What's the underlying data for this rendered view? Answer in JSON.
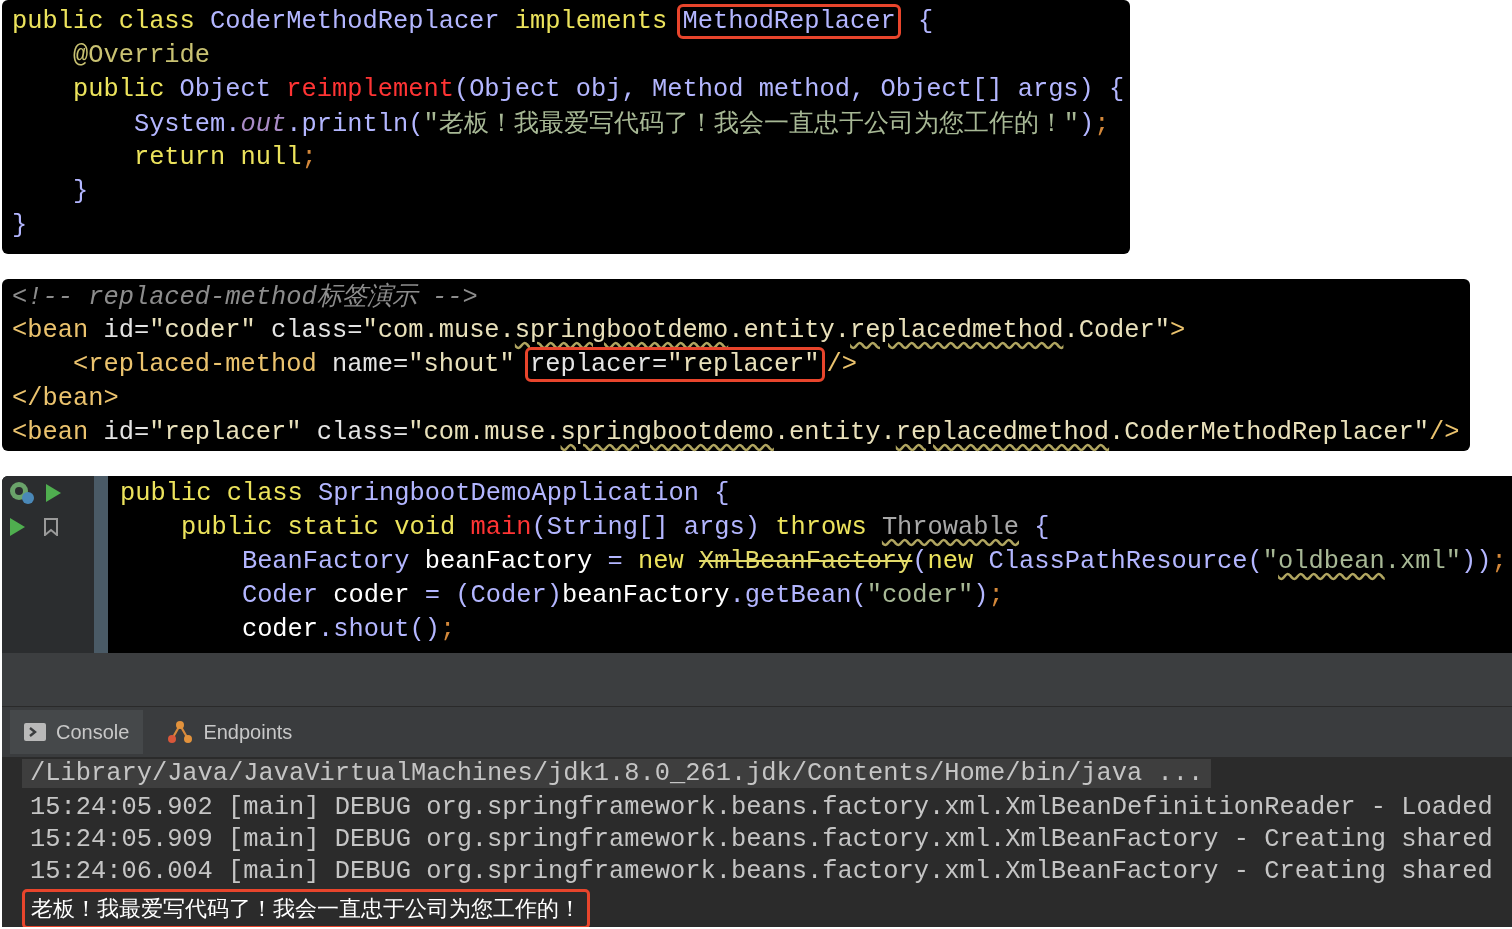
{
  "snippets": [
    {
      "lines": [
        {
          "tokens": [
            {
              "kind": "kw",
              "text": "public class "
            },
            {
              "kind": "type",
              "text": "CoderMethodReplacer "
            },
            {
              "kind": "kw",
              "text": "implements "
            }
          ],
          "boxed": [
            {
              "kind": "type",
              "text": "MethodReplacer"
            }
          ],
          "after": [
            {
              "kind": "type",
              "text": " {"
            }
          ]
        },
        {
          "tokens": [
            {
              "kind": "ann",
              "text": "    @Override"
            }
          ]
        },
        {
          "tokens": [
            {
              "kind": "kw",
              "text": "    public "
            },
            {
              "kind": "type",
              "text": "Object "
            },
            {
              "kind": "method",
              "text": "reimplement"
            },
            {
              "kind": "type",
              "text": "(Object obj, Method method, Object[] args) {"
            }
          ]
        },
        {
          "tokens": [
            {
              "kind": "type",
              "text": "        System."
            },
            {
              "kind": "field",
              "text": "out"
            },
            {
              "kind": "type",
              "text": ".println("
            },
            {
              "kind": "str",
              "text": "\"老板！我最爱写代码了！我会一直忠于公司为您工作的！\""
            },
            {
              "kind": "type",
              "text": ")"
            },
            {
              "kind": "punct",
              "text": ";"
            }
          ]
        },
        {
          "tokens": [
            {
              "kind": "kw",
              "text": "        return null"
            },
            {
              "kind": "punct",
              "text": ";"
            }
          ]
        },
        {
          "tokens": [
            {
              "kind": "type",
              "text": "    }"
            }
          ]
        },
        {
          "tokens": [
            {
              "kind": "type",
              "text": "}"
            }
          ]
        }
      ]
    },
    {
      "lines": [
        {
          "tokens": [
            {
              "kind": "comment",
              "text": "<!-- replaced-method标签演示 -->"
            }
          ]
        },
        {
          "tokens": [
            {
              "kind": "tag",
              "text": "<bean "
            },
            {
              "kind": "attr",
              "text": "id="
            },
            {
              "kind": "val",
              "text": "\"coder\" "
            },
            {
              "kind": "attr",
              "text": "class="
            },
            {
              "kind": "val",
              "text": "\"com.muse."
            },
            {
              "kind": "val",
              "text": "springbootdemo",
              "warned": true
            },
            {
              "kind": "val",
              "text": ".entity."
            },
            {
              "kind": "val",
              "text": "replacedmethod",
              "warned": true
            },
            {
              "kind": "val",
              "text": ".Coder\""
            },
            {
              "kind": "tag",
              "text": ">"
            }
          ]
        },
        {
          "tokens": [
            {
              "kind": "tag",
              "text": "    <replaced-method "
            },
            {
              "kind": "attr",
              "text": "name="
            },
            {
              "kind": "val",
              "text": "\"shout\" "
            }
          ],
          "boxed": [
            {
              "kind": "attr",
              "text": "replacer="
            },
            {
              "kind": "val",
              "text": "\"replacer\""
            }
          ],
          "after": [
            {
              "kind": "tag",
              "text": "/>"
            }
          ]
        },
        {
          "tokens": [
            {
              "kind": "tag",
              "text": "</bean>"
            }
          ]
        },
        {
          "tokens": [
            {
              "kind": "tag",
              "text": "<bean "
            },
            {
              "kind": "attr",
              "text": "id="
            },
            {
              "kind": "val",
              "text": "\"replacer\" "
            },
            {
              "kind": "attr",
              "text": "class="
            },
            {
              "kind": "val",
              "text": "\"com.muse."
            },
            {
              "kind": "val",
              "text": "springbootdemo",
              "warned": true
            },
            {
              "kind": "val",
              "text": ".entity."
            },
            {
              "kind": "val",
              "text": "replacedmethod",
              "warned": true
            },
            {
              "kind": "val",
              "text": ".CoderMethodReplacer\""
            },
            {
              "kind": "tag",
              "text": "/>"
            }
          ]
        }
      ]
    }
  ],
  "ide": {
    "lines": [
      {
        "tokens": [
          {
            "kind": "kw",
            "text": "public class "
          },
          {
            "kind": "type",
            "text": "SpringbootDemoApplication {"
          }
        ]
      },
      {
        "tokens": [
          {
            "kind": "kw",
            "text": "    public static void "
          },
          {
            "kind": "method",
            "text": "main"
          },
          {
            "kind": "type",
            "text": "(String[] args) "
          },
          {
            "kind": "kw",
            "text": "throws "
          },
          {
            "kind": "dim",
            "text": "Throwable",
            "warned": true
          },
          {
            "kind": "type",
            "text": " {"
          }
        ]
      },
      {
        "tokens": [
          {
            "kind": "type",
            "text": "        BeanFactory "
          },
          {
            "kind": "plain",
            "text": "beanFactory "
          },
          {
            "kind": "type",
            "text": "= "
          },
          {
            "kind": "kw",
            "text": "new "
          },
          {
            "kind": "deprecated",
            "text": "XmlBeanFactory"
          },
          {
            "kind": "type",
            "text": "("
          },
          {
            "kind": "kw",
            "text": "new "
          },
          {
            "kind": "type",
            "text": "ClassPathResource("
          },
          {
            "kind": "str",
            "text": "\""
          },
          {
            "kind": "str",
            "text": "oldbean",
            "warned": true
          },
          {
            "kind": "str",
            "text": ".xml\""
          },
          {
            "kind": "type",
            "text": "))"
          },
          {
            "kind": "punct",
            "text": ";"
          }
        ]
      },
      {
        "tokens": [
          {
            "kind": "type",
            "text": "        Coder "
          },
          {
            "kind": "plain",
            "text": "coder "
          },
          {
            "kind": "type",
            "text": "= (Coder)"
          },
          {
            "kind": "plain",
            "text": "beanFactory"
          },
          {
            "kind": "type",
            "text": ".getBean("
          },
          {
            "kind": "str",
            "text": "\"coder\""
          },
          {
            "kind": "type",
            "text": ")"
          },
          {
            "kind": "punct",
            "text": ";"
          }
        ]
      },
      {
        "tokens": [
          {
            "kind": "plain",
            "text": "        coder"
          },
          {
            "kind": "type",
            "text": ".shout()"
          },
          {
            "kind": "punct",
            "text": ";"
          }
        ]
      }
    ],
    "tabs": [
      {
        "label": "Console",
        "kind": "console",
        "selected": true
      },
      {
        "label": "Endpoints",
        "kind": "endpoints",
        "selected": false
      }
    ],
    "console": [
      {
        "kind": "command",
        "text": "/Library/Java/JavaVirtualMachines/jdk1.8.0_261.jdk/Contents/Home/bin/java ..."
      },
      {
        "kind": "log",
        "text": "15:24:05.902 [main] DEBUG org.springframework.beans.factory.xml.XmlBeanDefinitionReader - Loaded"
      },
      {
        "kind": "log",
        "text": "15:24:05.909 [main] DEBUG org.springframework.beans.factory.xml.XmlBeanFactory - Creating shared"
      },
      {
        "kind": "log",
        "text": "15:24:06.004 [main] DEBUG org.springframework.beans.factory.xml.XmlBeanFactory - Creating shared"
      },
      {
        "kind": "output",
        "text": "老板！我最爱写代码了！我会一直忠于公司为您工作的！"
      }
    ]
  }
}
